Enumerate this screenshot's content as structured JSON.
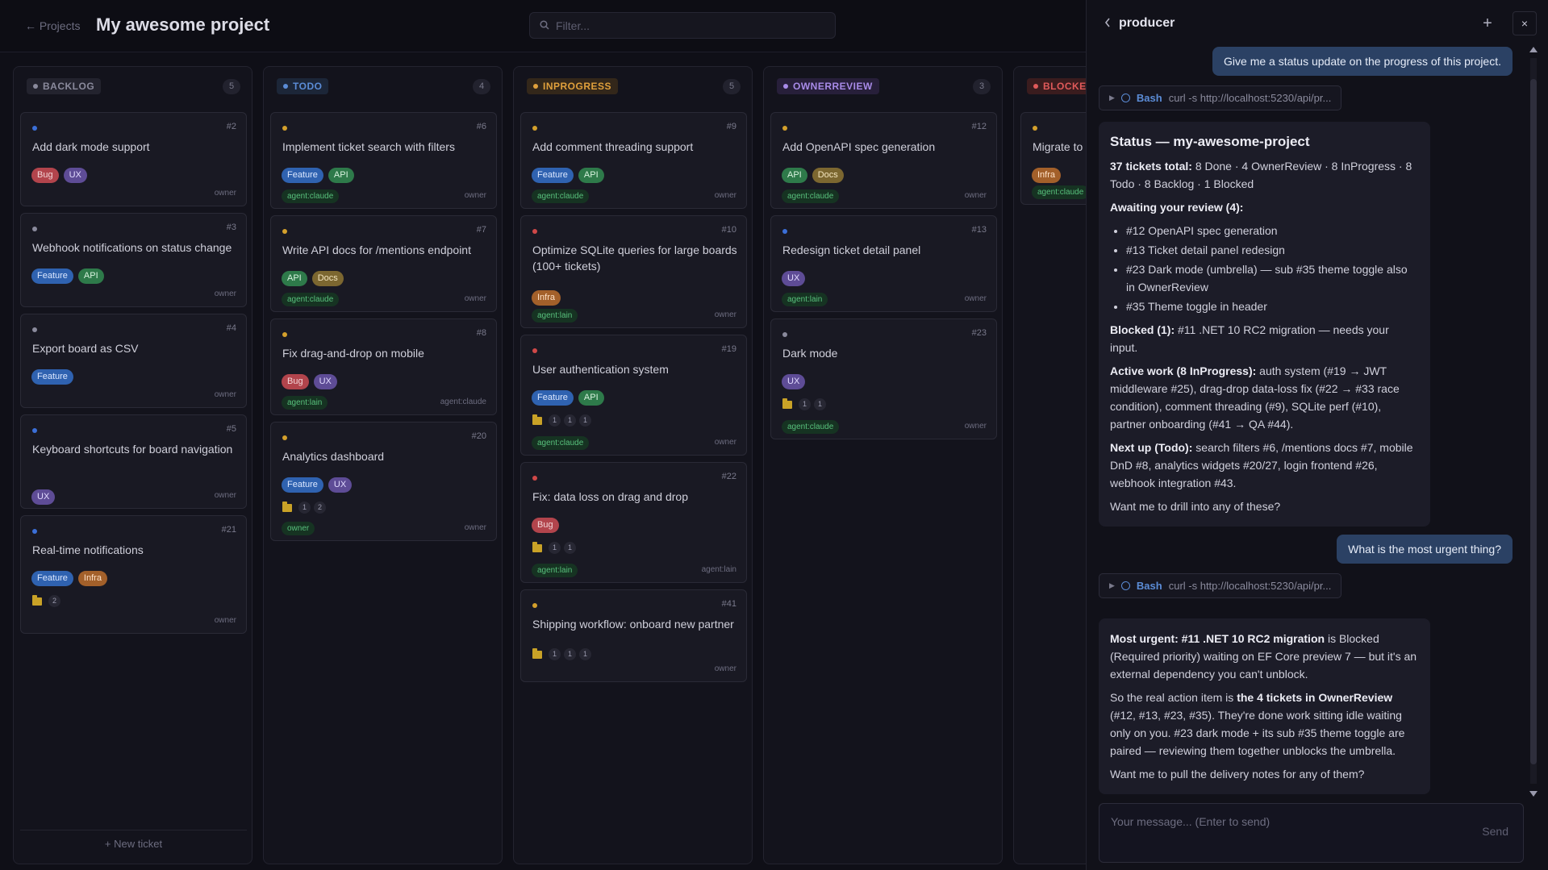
{
  "header": {
    "back_label": "← Projects",
    "title": "My awesome project",
    "filter_placeholder": "Filter..."
  },
  "columns": [
    {
      "id": "backlog",
      "label": "BACKLOG",
      "count": "5",
      "color": "#8a8a9c",
      "bg": "#23232e",
      "new_ticket": "+ New ticket",
      "cards": [
        {
          "num": "#2",
          "title": "Add dark mode support",
          "dot": "#3b6fd8",
          "tags": [
            "Bug",
            "UX"
          ],
          "owner": "owner"
        },
        {
          "num": "#3",
          "title": "Webhook notifications on status change",
          "dot": "#8a8a9c",
          "tags": [
            "Feature",
            "API"
          ],
          "owner": "owner"
        },
        {
          "num": "#4",
          "title": "Export board as CSV",
          "dot": "#8a8a9c",
          "tags": [
            "Feature"
          ],
          "owner": "owner"
        },
        {
          "num": "#5",
          "title": "Keyboard shortcuts for board navigation",
          "dot": "#3b6fd8",
          "tags": [
            "UX"
          ],
          "owner": "owner"
        },
        {
          "num": "#21",
          "title": "Real-time notifications",
          "dot": "#3b6fd8",
          "tags": [
            "Feature",
            "Infra"
          ],
          "badges": [
            "2"
          ],
          "owner": "owner"
        }
      ]
    },
    {
      "id": "todo",
      "label": "TODO",
      "count": "4",
      "color": "#5b8cd6",
      "bg": "#1c2638",
      "cards": [
        {
          "num": "#6",
          "title": "Implement ticket search with filters",
          "dot": "#d4a02c",
          "tags": [
            "Feature",
            "API"
          ],
          "agent": "agent:claude",
          "owner": "owner"
        },
        {
          "num": "#7",
          "title": "Write API docs for /mentions endpoint",
          "dot": "#d4a02c",
          "tags": [
            "API",
            "Docs"
          ],
          "agent": "agent:claude",
          "owner": "owner"
        },
        {
          "num": "#8",
          "title": "Fix drag-and-drop on mobile",
          "dot": "#d4a02c",
          "tags": [
            "Bug",
            "UX"
          ],
          "agent": "agent:lain",
          "owner": "agent:claude"
        },
        {
          "num": "#20",
          "title": "Analytics dashboard",
          "dot": "#d4a02c",
          "tags": [
            "Feature",
            "UX"
          ],
          "badges": [
            "1",
            "2"
          ],
          "agent": "owner",
          "owner": "owner"
        }
      ]
    },
    {
      "id": "inprogress",
      "label": "INPROGRESS",
      "count": "5",
      "color": "#e0a03c",
      "bg": "#33271a",
      "cards": [
        {
          "num": "#9",
          "title": "Add comment threading support",
          "dot": "#d4a02c",
          "tags": [
            "Feature",
            "API"
          ],
          "agent": "agent:claude",
          "owner": "owner"
        },
        {
          "num": "#10",
          "title": "Optimize SQLite queries for large boards (100+ tickets)",
          "dot": "#d04848",
          "tags": [
            "Infra"
          ],
          "agent": "agent:lain",
          "owner": "owner"
        },
        {
          "num": "#19",
          "title": "User authentication system",
          "dot": "#d04848",
          "tags": [
            "Feature",
            "API"
          ],
          "badges": [
            "1",
            "1",
            "1"
          ],
          "agent": "agent:claude",
          "owner": "owner"
        },
        {
          "num": "#22",
          "title": "Fix: data loss on drag and drop",
          "dot": "#d04848",
          "tags": [
            "Bug"
          ],
          "badges": [
            "1",
            "1"
          ],
          "agent": "agent:lain",
          "owner": "agent:lain"
        },
        {
          "num": "#41",
          "title": "Shipping workflow: onboard new partner",
          "dot": "#d4a02c",
          "tags": [],
          "badges": [
            "1",
            "1",
            "1"
          ],
          "owner": "owner"
        }
      ]
    },
    {
      "id": "ownerreview",
      "label": "OWNERREVIEW",
      "count": "3",
      "color": "#a88be8",
      "bg": "#271f3a",
      "cards": [
        {
          "num": "#12",
          "title": "Add OpenAPI spec generation",
          "dot": "#d4a02c",
          "tags": [
            "API",
            "Docs"
          ],
          "agent": "agent:claude",
          "owner": "owner"
        },
        {
          "num": "#13",
          "title": "Redesign ticket detail panel",
          "dot": "#3b6fd8",
          "tags": [
            "UX"
          ],
          "agent": "agent:lain",
          "owner": "owner"
        },
        {
          "num": "#23",
          "title": "Dark mode",
          "dot": "#8a8a9c",
          "tags": [
            "UX"
          ],
          "badges": [
            "1",
            "1"
          ],
          "agent": "agent:claude",
          "owner": "owner"
        }
      ]
    },
    {
      "id": "blocked",
      "label": "BLOCKED",
      "count": "",
      "color": "#e05a5a",
      "bg": "#3a1c1e",
      "cards": [
        {
          "num": "",
          "title": "Migrate to",
          "dot": "#d4a02c",
          "tags": [
            "Infra"
          ],
          "agent": "agent:claude",
          "owner": ""
        }
      ]
    }
  ],
  "chat": {
    "title": "producer",
    "plus_label": "+",
    "close_label": "×",
    "input_placeholder": "Your message... (Enter to send)",
    "send_label": "Send",
    "user_msg_1": "Give me a status update on the progress of this project.",
    "tool_1": {
      "name": "Bash",
      "cmd": "curl -s http://localhost:5230/api/pr..."
    },
    "status": {
      "heading": "Status — my-awesome-project",
      "total_bold": "37 tickets total:",
      "total_rest": " 8 Done · 4 OwnerReview · 8 InProgress · 8 Todo · 8 Backlog · 1 Blocked",
      "awaiting": "Awaiting your review (4):",
      "awaiting_items": [
        "#12 OpenAPI spec generation",
        "#13 Ticket detail panel redesign",
        "#23 Dark mode (umbrella) — sub #35 theme toggle also in OwnerReview",
        "#35 Theme toggle in header"
      ],
      "blocked_bold": "Blocked (1):",
      "blocked_rest": " #11 .NET 10 RC2 migration — needs your input.",
      "active_bold": "Active work (8 InProgress):",
      "active_rest": " auth system (#19 → JWT middleware #25), drag-drop data-loss fix (#22 → #33 race condition), comment threading (#9), SQLite perf (#10), partner onboarding (#41 → QA #44).",
      "next_bold": "Next up (Todo):",
      "next_rest": " search filters #6, /mentions docs #7, mobile DnD #8, analytics widgets #20/27, login frontend #26, webhook integration #43.",
      "closing": "Want me to drill into any of these?"
    },
    "user_msg_2": "What is the most urgent thing?",
    "tool_2": {
      "name": "Bash",
      "cmd": "curl -s http://localhost:5230/api/pr..."
    },
    "urgent": {
      "bold1": "Most urgent: #11 .NET 10 RC2 migration",
      "rest1": " is Blocked (Required priority) waiting on EF Core preview 7 — but it's an external dependency you can't unblock.",
      "pre2": "So the real action item is ",
      "bold2": "the 4 tickets in OwnerReview",
      "rest2": " (#12, #13, #23, #35). They're done work sitting idle waiting only on you. #23 dark mode + its sub #35 theme toggle are paired — reviewing them together unblocks the umbrella.",
      "closing": "Want me to pull the delivery notes for any of them?"
    }
  }
}
